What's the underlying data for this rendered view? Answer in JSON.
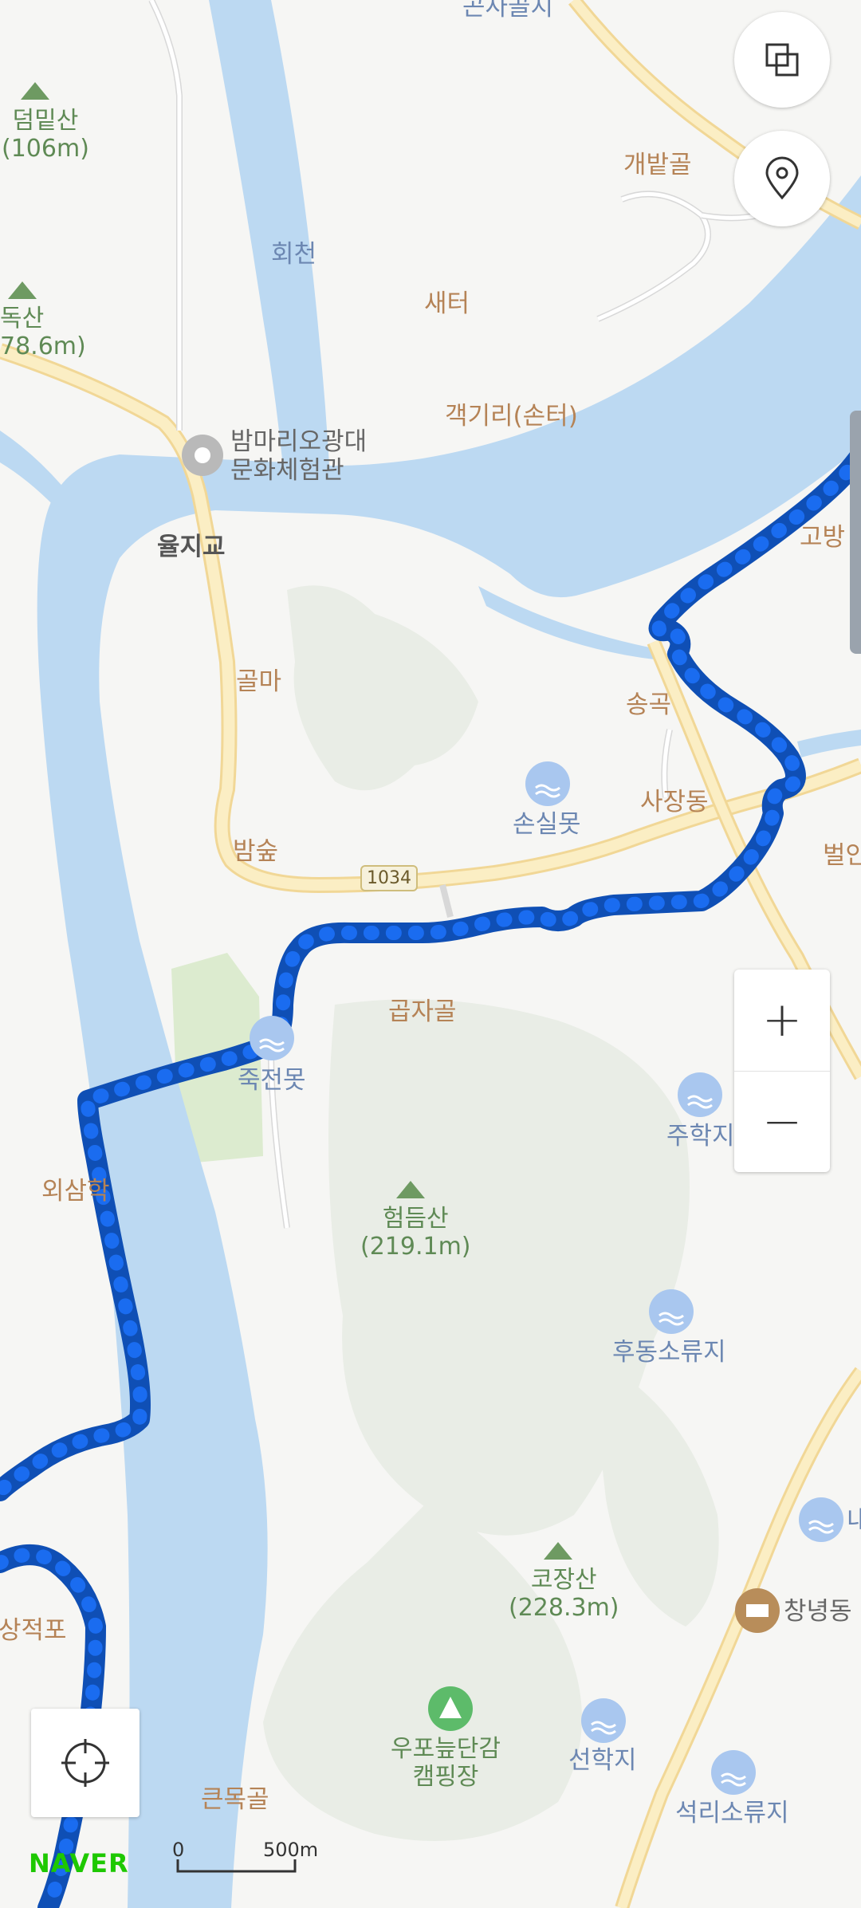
{
  "map": {
    "provider_logo": "NAVER",
    "scale": {
      "start": "0",
      "end": "500m"
    },
    "road_badge": "1034",
    "colors": {
      "water": "#bcd9f2",
      "route": "#1565d8",
      "road": "#fbe8b5",
      "forest": "#e7ebe3"
    },
    "places": {
      "gonsagolji": "곤사골지",
      "gaebatgol": "개밭골",
      "saeteo": "새터",
      "gaekgiri": "객기리(손터)",
      "golma": "골마",
      "songgok": "송곡",
      "sajangdong": "사장동",
      "bamsup": "밤숲",
      "gopjagol": "곱자골",
      "oesamhak": "외삼학",
      "sangjeokpo": "상적포",
      "keunmokgol": "큰목골",
      "gobang": "고방",
      "beoban": "벌안"
    },
    "mountains": {
      "deommit_name": "덤밑산",
      "deommit_height": "(106m)",
      "dok_name": "독산",
      "dok_height": "78.6m)",
      "heomdeum_name": "험듬산",
      "heomdeum_height": "(219.1m)",
      "kojang_name": "코장산",
      "kojang_height": "(228.3m)"
    },
    "water": {
      "hoecheon": "회천",
      "sonsilmot": "손실못",
      "jukjeonmot": "죽전못",
      "juhakji": "주학지",
      "hudongsoryuji": "후동소류지",
      "seonhakji": "선학지",
      "seokrisoryuji": "석리소류지",
      "na": "내"
    },
    "facilities": {
      "culture_line1": "밤마리오광대",
      "culture_line2": "문화체험관",
      "bridge": "율지교",
      "camp_line1": "우포늪단감",
      "camp_line2": "캠핑장",
      "changnyeong": "창녕동"
    }
  }
}
